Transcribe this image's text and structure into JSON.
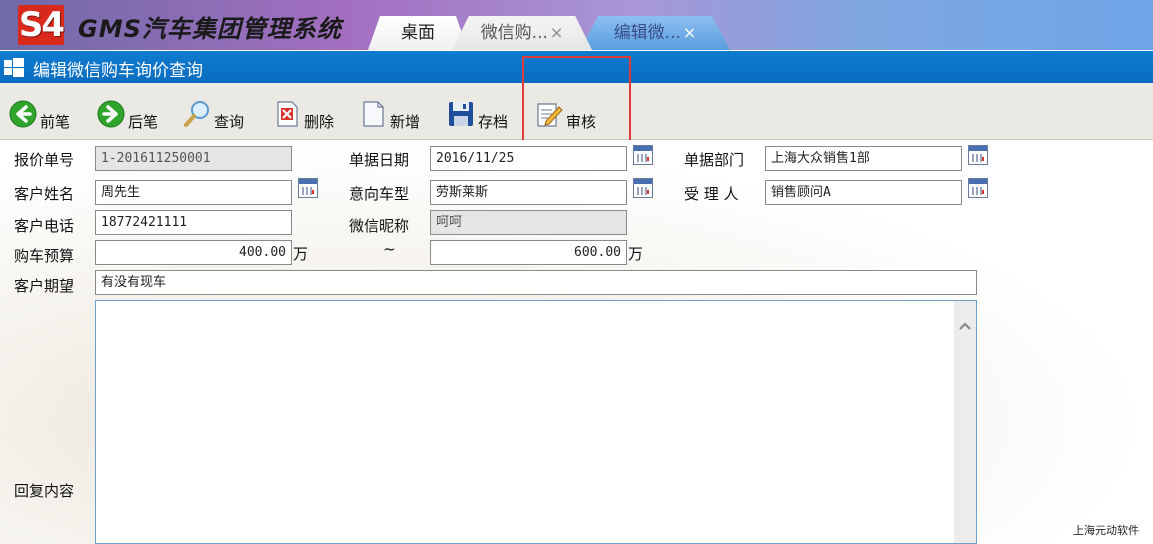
{
  "header": {
    "logo_mark": "S4",
    "app_title": "GMS汽车集团管理系统",
    "tabs": [
      {
        "label": "桌面",
        "close": ""
      },
      {
        "label": "微信购...",
        "close": "×"
      },
      {
        "label": "编辑微...",
        "close": "×"
      }
    ]
  },
  "titlebar": {
    "title": "编辑微信购车询价查询"
  },
  "toolbar": {
    "prev": "前笔",
    "next": "后笔",
    "query": "查询",
    "delete": "删除",
    "new": "新增",
    "save": "存档",
    "audit": "审核"
  },
  "form": {
    "quote_no": {
      "label": "报价单号",
      "value": "1-201611250001"
    },
    "doc_date": {
      "label": "单据日期",
      "value": "2016/11/25"
    },
    "dept": {
      "label": "单据部门",
      "value": "上海大众销售1部"
    },
    "customer_name": {
      "label": "客户姓名",
      "value": "周先生"
    },
    "intended_model": {
      "label": "意向车型",
      "value": "劳斯莱斯"
    },
    "handler": {
      "label": "受 理 人",
      "value": "销售顾问A"
    },
    "customer_phone": {
      "label": "客户电话",
      "value": "18772421111"
    },
    "wechat_nick": {
      "label": "微信昵称",
      "value": "呵呵"
    },
    "budget": {
      "label": "购车预算",
      "min": "400.00",
      "max": "600.00",
      "unit": "万",
      "separator": "~"
    },
    "expectation": {
      "label": "客户期望",
      "value": "有没有现车"
    },
    "reply": {
      "label": "回复内容",
      "value": ""
    }
  },
  "footer": {
    "vendor": "上海元动软件"
  },
  "colors": {
    "titlebar": "#0a6cc0",
    "highlight": "#e03a3a",
    "logo_red": "#d9291c"
  }
}
